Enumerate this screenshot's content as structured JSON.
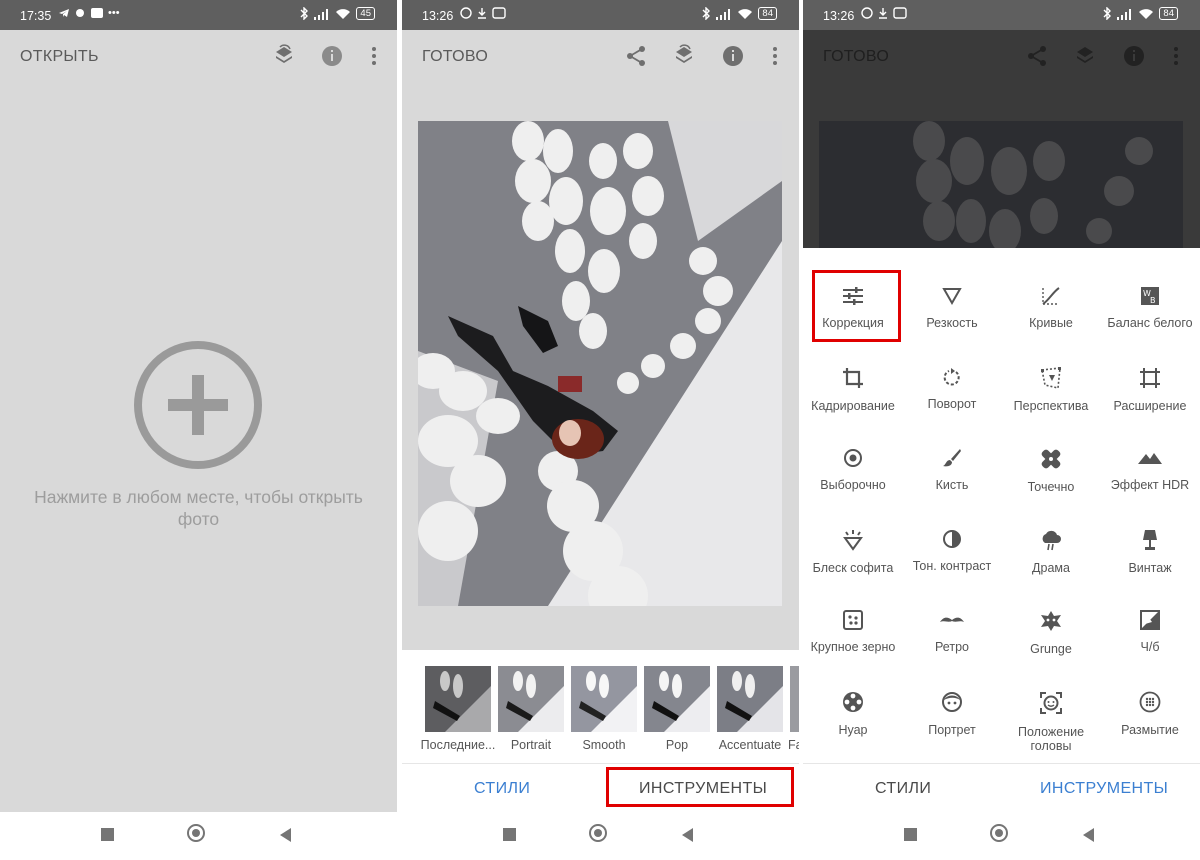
{
  "phone1": {
    "status": {
      "time": "17:35",
      "battery": "45"
    },
    "appbar": {
      "title": "ОТКРЫТЬ"
    },
    "hint": "Нажмите в любом месте, чтобы открыть фото"
  },
  "phone2": {
    "status": {
      "time": "13:26",
      "battery": "84"
    },
    "appbar": {
      "title": "ГОТОВО"
    },
    "styles": [
      {
        "label": "Последние..."
      },
      {
        "label": "Portrait"
      },
      {
        "label": "Smooth"
      },
      {
        "label": "Pop"
      },
      {
        "label": "Accentuate"
      },
      {
        "label": "Fa"
      }
    ],
    "tabs": {
      "styles": "СТИЛИ",
      "tools": "ИНСТРУМЕНТЫ"
    }
  },
  "phone3": {
    "status": {
      "time": "13:26",
      "battery": "84"
    },
    "appbar": {
      "title": "ГОТОВО"
    },
    "tools": [
      {
        "label": "Коррекция",
        "icon": "tune-icon"
      },
      {
        "label": "Резкость",
        "icon": "triangle-icon"
      },
      {
        "label": "Кривые",
        "icon": "curves-icon"
      },
      {
        "label": "Баланс белого",
        "icon": "white-balance-icon"
      },
      {
        "label": "Кадрирование",
        "icon": "crop-icon"
      },
      {
        "label": "Поворот",
        "icon": "rotate-icon"
      },
      {
        "label": "Перспектива",
        "icon": "perspective-icon"
      },
      {
        "label": "Расширение",
        "icon": "expand-icon"
      },
      {
        "label": "Выборочно",
        "icon": "selective-icon"
      },
      {
        "label": "Кисть",
        "icon": "brush-icon"
      },
      {
        "label": "Точечно",
        "icon": "healing-icon"
      },
      {
        "label": "Эффект HDR",
        "icon": "hdr-icon"
      },
      {
        "label": "Блеск софита",
        "icon": "glamour-glow-icon"
      },
      {
        "label": "Тон. контраст",
        "icon": "tonal-contrast-icon"
      },
      {
        "label": "Драма",
        "icon": "drama-icon"
      },
      {
        "label": "Винтаж",
        "icon": "vintage-icon"
      },
      {
        "label": "Крупное зерно",
        "icon": "grainy-film-icon"
      },
      {
        "label": "Ретро",
        "icon": "retrolux-icon"
      },
      {
        "label": "Grunge",
        "icon": "grunge-icon"
      },
      {
        "label": "Ч/б",
        "icon": "black-white-icon"
      },
      {
        "label": "Нуар",
        "icon": "noir-icon"
      },
      {
        "label": "Портрет",
        "icon": "portrait-icon"
      },
      {
        "label": "Положение головы",
        "icon": "head-pose-icon"
      },
      {
        "label": "Размытие",
        "icon": "blur-icon"
      }
    ],
    "tabs": {
      "styles": "СТИЛИ",
      "tools": "ИНСТРУМЕНТЫ"
    }
  },
  "colors": {
    "accent": "#3b7fd1",
    "highlight": "#e00000",
    "statusbar": "#5f5f5f"
  }
}
